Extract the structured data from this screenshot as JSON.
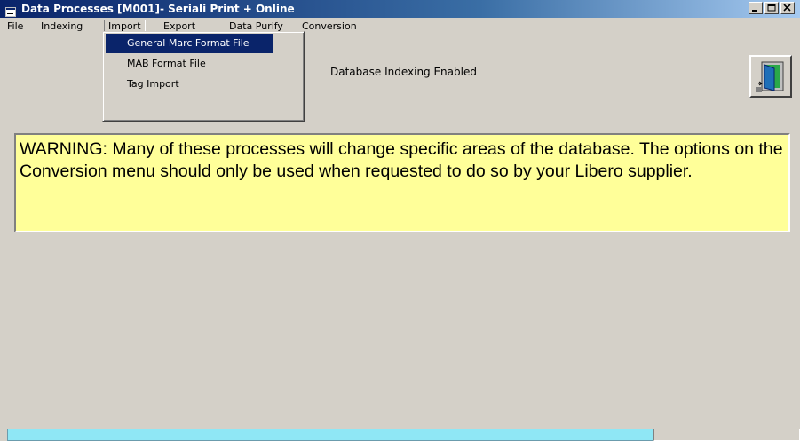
{
  "window": {
    "title": "Data Processes  [M001]- Seriali Print + Online",
    "minimize_label": "_",
    "maximize_label": "□",
    "close_label": "x"
  },
  "menu": {
    "file": "File",
    "indexing": "Indexing",
    "import": "Import",
    "export": "Export",
    "data_purify": "Data Purify",
    "conversion": "Conversion"
  },
  "import_menu": {
    "items": [
      "General Marc Format File",
      "MAB Format File",
      "Tag Import"
    ],
    "highlighted": "General Marc Format File"
  },
  "status": {
    "indexing": "Database Indexing Enabled"
  },
  "warning": {
    "text": "WARNING:   Many of these processes will change specific areas of the database.  The options on the Conversion menu should only be used when requested to do so by your Libero supplier."
  },
  "icons": {
    "app": "app-window-icon",
    "exit": "exit-door-icon"
  },
  "colors": {
    "title_bar": "#0a246a",
    "warning_background": "#ffff99",
    "progress_fill": "#8fe7f5",
    "menu_highlight": "#0a246a"
  }
}
